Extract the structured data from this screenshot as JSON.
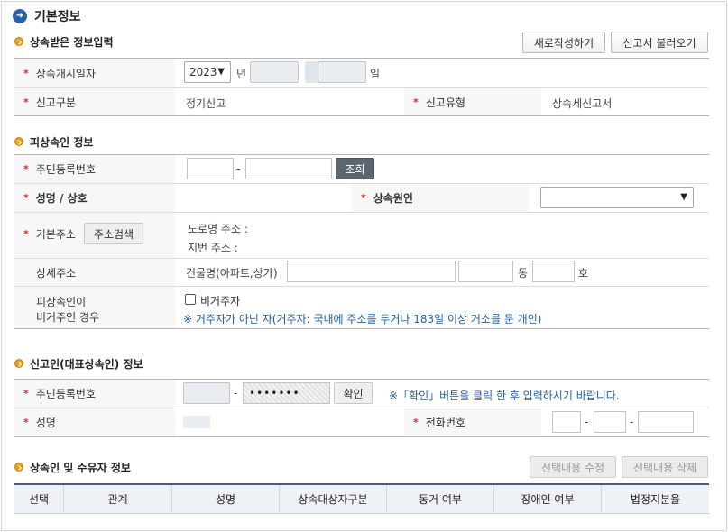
{
  "page": {
    "title": "기본정보"
  },
  "sections": {
    "heir_input": "상속받은 정보입력",
    "decedent": "피상속인 정보",
    "reporter": "신고인(대표상속인) 정보",
    "heirs": "상속인 및 수유자 정보"
  },
  "buttons": {
    "new_write": "새로작성하기",
    "load_report": "신고서 불러오기",
    "lookup": "조회",
    "address_search": "주소검색",
    "confirm": "확인",
    "edit_selected": "선택내용 수정",
    "delete_selected": "선택내용 삭제"
  },
  "heir_input": {
    "start_date_label": "상속개시일자",
    "year_value": "2023",
    "year_unit": "년",
    "day_unit": "일",
    "report_type_label": "신고구분",
    "report_type_value": "정기신고",
    "report_kind_label": "신고유형",
    "report_kind_value": "상속세신고서"
  },
  "decedent": {
    "rrn_label": "주민등록번호",
    "rrn_sep": "-",
    "name_label": "성명 / 상호",
    "cause_label": "상속원인",
    "address_label": "기본주소",
    "road_address": "도로명 주소 :",
    "lot_address": "지번 주소 :",
    "detail_label": "상세주소",
    "building_label": "건물명(아파트,상가)",
    "dong_unit": "동",
    "ho_unit": "호",
    "nonresident_label_1": "피상속인이",
    "nonresident_label_2": "비거주인 경우",
    "nonresident_check": "비거주자",
    "nonresident_note": "※ 거주자가 아닌 자(거주자: 국내에 주소를 두거나 183일 이상 거소를 둔 개인)"
  },
  "reporter": {
    "rrn_label": "주민등록번호",
    "rrn_sep": "-",
    "rrn_masked": "•••••••",
    "confirm_note": "※「확인」버튼을 클릭 한 후 입력하시기 바랍니다.",
    "name_label": "성명",
    "phone_label": "전화번호",
    "phone_sep": "-"
  },
  "heirs_table": {
    "columns": [
      "선택",
      "관계",
      "성명",
      "상속대상자구분",
      "동거 여부",
      "장애인 여부",
      "법정지분율"
    ]
  },
  "colors": {
    "required": "#c8302b",
    "note": "#1f5f9e",
    "title_icon": "#2b5fa8",
    "section_bullet": "#e8a020",
    "lookup_button": "#5b6670"
  },
  "icons": {
    "title": "arrow-right-circle-icon",
    "section": "section-bullet-icon",
    "select": "chevron-down-icon"
  }
}
